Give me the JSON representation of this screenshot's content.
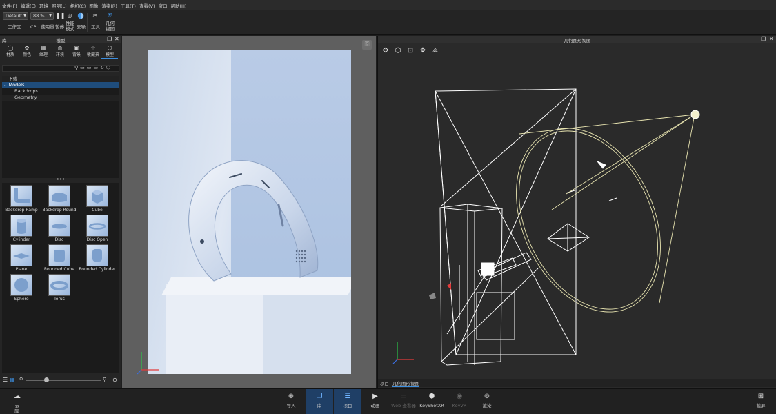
{
  "menu": [
    "文件(F)",
    "编辑(E)",
    "环境",
    "照明(L)",
    "相机(C)",
    "图像",
    "渲染(R)",
    "工具(T)",
    "查看(V)",
    "窗口",
    "帮助(H)"
  ],
  "toolbar": {
    "workspace_value": "Default",
    "zoom_value": "88 %",
    "workspace_label": "工作区",
    "cpu_label": "CPU 使用量",
    "pause_label": "暂停",
    "perf_label_1": "性能",
    "perf_label_2": "模式",
    "denoise_label": "去噪",
    "tools_label": "工具",
    "geo_label_1": "几何",
    "geo_label_2": "视图"
  },
  "left_panel": {
    "lib_label": "库",
    "title": "模型",
    "tabs": [
      {
        "label": "材质",
        "icon": "sphere-icon"
      },
      {
        "label": "颜色",
        "icon": "palette-icon"
      },
      {
        "label": "纹理",
        "icon": "checker-icon"
      },
      {
        "label": "环境",
        "icon": "globe-icon"
      },
      {
        "label": "背景",
        "icon": "image-icon"
      },
      {
        "label": "收藏夹",
        "icon": "star-icon"
      },
      {
        "label": "模型",
        "icon": "models-icon"
      }
    ],
    "tree": {
      "download": "下载",
      "models": "Models",
      "children": [
        "Backdrops",
        "Geometry"
      ]
    },
    "thumbnails": [
      "Backdrop Ramp",
      "Backdrop Round",
      "Cube",
      "Cylinder",
      "Disc",
      "Disc Open",
      "Plane",
      "Rounded Cube",
      "Rounded Cylinder",
      "Sphere",
      "Torus"
    ]
  },
  "right_panel": {
    "title": "几何图形视图",
    "bottom_tabs": [
      "项目",
      "几何图形视图"
    ]
  },
  "bottombar": {
    "cloud_label_1": "云",
    "cloud_label_2": "库",
    "buttons": [
      {
        "label": "导入",
        "icon": "import-icon",
        "state": "normal"
      },
      {
        "label": "库",
        "icon": "book-icon",
        "state": "active"
      },
      {
        "label": "项目",
        "icon": "list-icon",
        "state": "active"
      },
      {
        "label": "动画",
        "icon": "play-icon",
        "state": "normal"
      },
      {
        "label": "Web 查看器",
        "icon": "monitor-icon",
        "state": "disabled"
      },
      {
        "label": "KeyShotXR",
        "icon": "xr-icon",
        "state": "normal"
      },
      {
        "label": "KeyVR",
        "icon": "vr-icon",
        "state": "disabled"
      },
      {
        "label": "渲染",
        "icon": "render-icon",
        "state": "normal"
      }
    ],
    "screenshot_label": "截屏"
  },
  "colors": {
    "accent": "#3d8fe0",
    "selection": "#1f4d7c",
    "wireframe": "#ffffff",
    "light_cone": "#e8e4b0"
  }
}
